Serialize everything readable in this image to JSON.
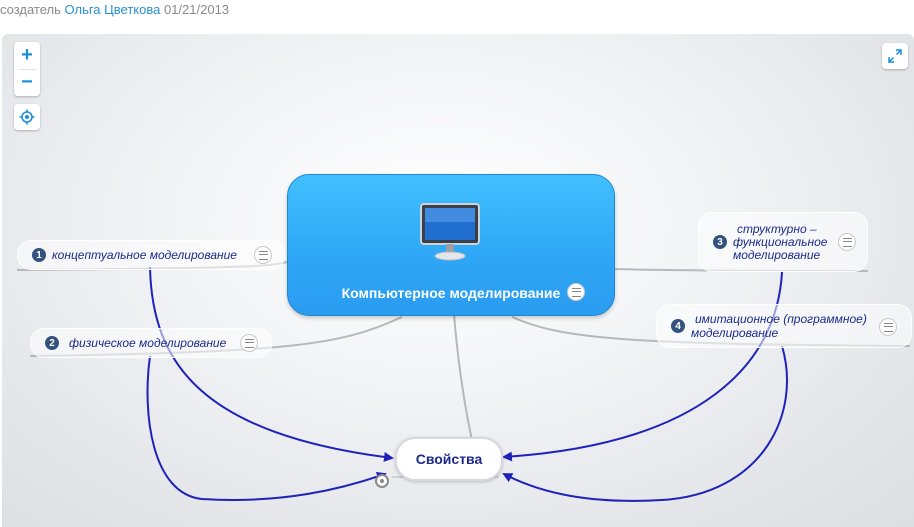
{
  "byline": {
    "prefix": "создатель",
    "author": "Ольга Цветкова",
    "date": "01/21/2013"
  },
  "controls": {
    "zoom_in": "+",
    "zoom_out": "−",
    "center_icon": "target-icon",
    "fullscreen_icon": "expand-icon"
  },
  "map": {
    "central": {
      "title": "Компьютерное моделирование",
      "icon": "monitor-icon",
      "color": "#36b0fa"
    },
    "branches": [
      {
        "number": "1",
        "label": "концептуальное моделирование"
      },
      {
        "number": "2",
        "label": "физическое моделирование"
      },
      {
        "number": "3",
        "label_lines": [
          "структурно –",
          "функциональное",
          "моделирование"
        ]
      },
      {
        "number": "4",
        "label_lines": [
          "имитационное (программное)",
          "моделирование"
        ]
      }
    ],
    "target": {
      "label": "Свойства"
    },
    "link_color": "#1f22b8"
  }
}
